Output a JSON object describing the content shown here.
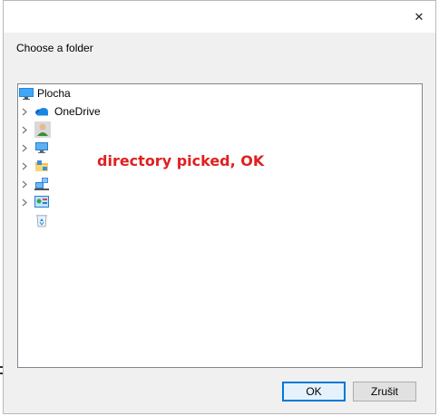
{
  "dialog": {
    "close_glyph": "✕",
    "prompt": "Choose a folder",
    "ok_label": "OK",
    "cancel_label": "Zrušit"
  },
  "tree": {
    "items": [
      {
        "label": "Plocha",
        "icon": "desktop-icon",
        "expandable": false
      },
      {
        "label": "OneDrive",
        "icon": "onedrive-cloud-icon",
        "expandable": true
      },
      {
        "label": "",
        "icon": "user-folder-icon",
        "expandable": true
      },
      {
        "label": "",
        "icon": "this-pc-icon",
        "expandable": true
      },
      {
        "label": "",
        "icon": "libraries-icon",
        "expandable": true
      },
      {
        "label": "",
        "icon": "network-icon",
        "expandable": true
      },
      {
        "label": "",
        "icon": "control-panel-icon",
        "expandable": true
      },
      {
        "label": "",
        "icon": "recycle-bin-icon",
        "expandable": false
      }
    ]
  },
  "overlay": {
    "status_text": "directory picked, OK",
    "status_color": "#e02020"
  },
  "colors": {
    "accent": "#0078d7",
    "dialog_bg": "#f0f0f0"
  }
}
